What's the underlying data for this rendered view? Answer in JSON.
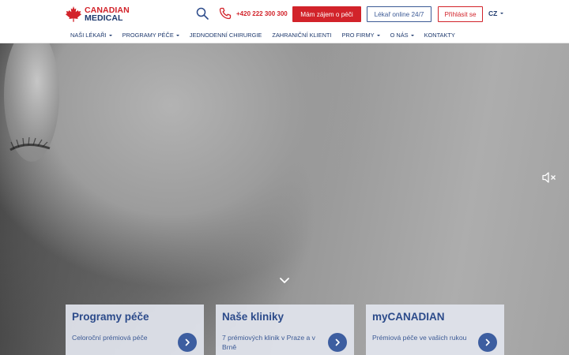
{
  "brand": {
    "line1": "CANADIAN",
    "line2": "MEDICAL",
    "accent_red": "#d2232a",
    "accent_blue": "#1f3a6e"
  },
  "header": {
    "phone": "+420 222 300 300",
    "care_button": "Mám zájem o péči",
    "online_button": "Lékař online 24/7",
    "login_button": "Přihlásit se",
    "language": "CZ"
  },
  "nav": {
    "items": [
      {
        "label": "NAŠI LÉKAŘI",
        "dropdown": true
      },
      {
        "label": "PROGRAMY PÉČE",
        "dropdown": true
      },
      {
        "label": "JEDNODENNÍ CHIRURGIE",
        "dropdown": false
      },
      {
        "label": "ZAHRANIČNÍ KLIENTI",
        "dropdown": false
      },
      {
        "label": "PRO FIRMY",
        "dropdown": true
      },
      {
        "label": "O NÁS",
        "dropdown": true
      },
      {
        "label": "KONTAKTY",
        "dropdown": false
      }
    ]
  },
  "icons": {
    "search": "search-icon",
    "phone": "phone-icon",
    "mute": "speaker-muted-icon",
    "scroll": "chevron-down-icon",
    "arrow": "chevron-right-icon"
  },
  "cards": [
    {
      "title": "Programy péče",
      "text": "Celoroční prémiová péče"
    },
    {
      "title": "Naše kliniky",
      "text": "7 prémiových klinik v Praze a v Brně"
    },
    {
      "title": "myCANADIAN",
      "text": "Prémiová péče ve vašich rukou"
    }
  ]
}
